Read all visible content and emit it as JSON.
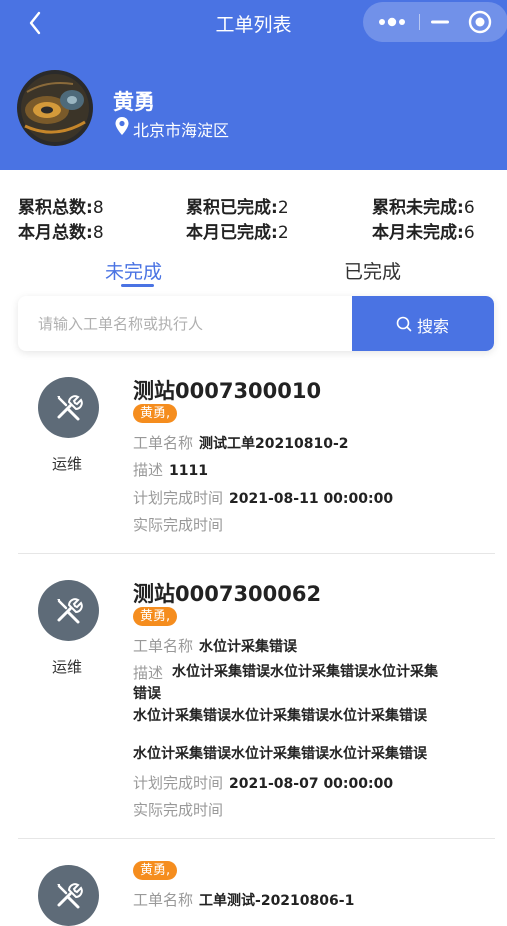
{
  "nav": {
    "title": "工单列表"
  },
  "profile": {
    "name": "黄勇",
    "location": "北京市海淀区"
  },
  "stats": {
    "total_label": "累积总数:",
    "total_value": "8",
    "done_label": "累积已完成:",
    "done_value": "2",
    "undone_label": "累积未完成:",
    "undone_value": "6",
    "month_total_label": "本月总数:",
    "month_total_value": "8",
    "month_done_label": "本月已完成:",
    "month_done_value": "2",
    "month_undone_label": "本月未完成:",
    "month_undone_value": "6"
  },
  "tabs": {
    "incomplete": "未完成",
    "complete": "已完成"
  },
  "search": {
    "placeholder": "请输入工单名称或执行人",
    "button": "搜索"
  },
  "orders": [
    {
      "type": "运维",
      "title": "测站0007300010",
      "assignee": "黄勇,",
      "name_label": "工单名称",
      "name": "测试工单20210810-2",
      "desc_label": "描述",
      "desc": "1111",
      "plan_label": "计划完成时间",
      "plan": "2021-08-11 00:00:00",
      "actual_label": "实际完成时间"
    },
    {
      "type": "运维",
      "title": "测站0007300062",
      "assignee": "黄勇,",
      "name_label": "工单名称",
      "name": "水位计采集错误",
      "desc_label": "描述",
      "desc_line1": "水位计采集错误水位计采集错误水位计采集",
      "desc_line2": "错误",
      "desc_line3": "水位计采集错误水位计采集错误水位计采集错误",
      "desc_line4": "水位计采集错误水位计采集错误水位计采集错误",
      "plan_label": "计划完成时间",
      "plan": "2021-08-07 00:00:00",
      "actual_label": "实际完成时间"
    },
    {
      "assignee": "黄勇,",
      "name_label": "工单名称",
      "name": "工单测试-20210806-1"
    }
  ],
  "colors": {
    "primary": "#4a73e3",
    "badge": "#f58d1e",
    "icon_bg": "#5e6b78"
  }
}
